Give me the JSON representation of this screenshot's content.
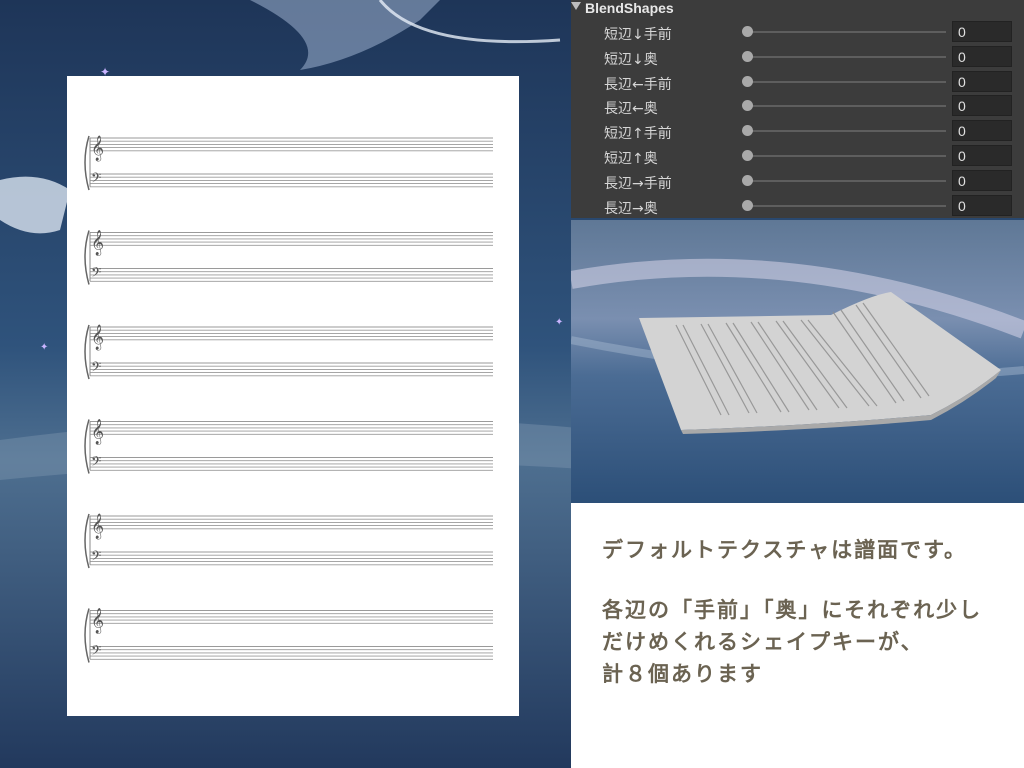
{
  "inspector": {
    "title": "BlendShapes",
    "rows": [
      {
        "label": "短辺↓手前",
        "value": "0",
        "level": 0
      },
      {
        "label": "短辺↓奥",
        "value": "0",
        "level": 0
      },
      {
        "label": "長辺←手前",
        "value": "0",
        "level": 0
      },
      {
        "label": "長辺←奥",
        "value": "0",
        "level": 0
      },
      {
        "label": "短辺↑手前",
        "value": "0",
        "level": 0
      },
      {
        "label": "短辺↑奥",
        "value": "0",
        "level": 0
      },
      {
        "label": "長辺→手前",
        "value": "0",
        "level": 0
      },
      {
        "label": "長辺→奥",
        "value": "0",
        "level": 0
      }
    ]
  },
  "sheet": {
    "systems": 6
  },
  "description": {
    "lines": [
      "デフォルトテクスチャは譜面です。",
      "",
      "各辺の「手前」「奥」にそれぞれ少し",
      "だけめくれるシェイプキーが、",
      "計８個あります"
    ]
  },
  "icons": {
    "collapse": "triangle-down-icon",
    "treble": "treble-clef-icon",
    "bass": "bass-clef-icon"
  },
  "colors": {
    "panel": "#3c3c3c",
    "text_accent": "#6b6352",
    "scene": "#2c4a70"
  }
}
